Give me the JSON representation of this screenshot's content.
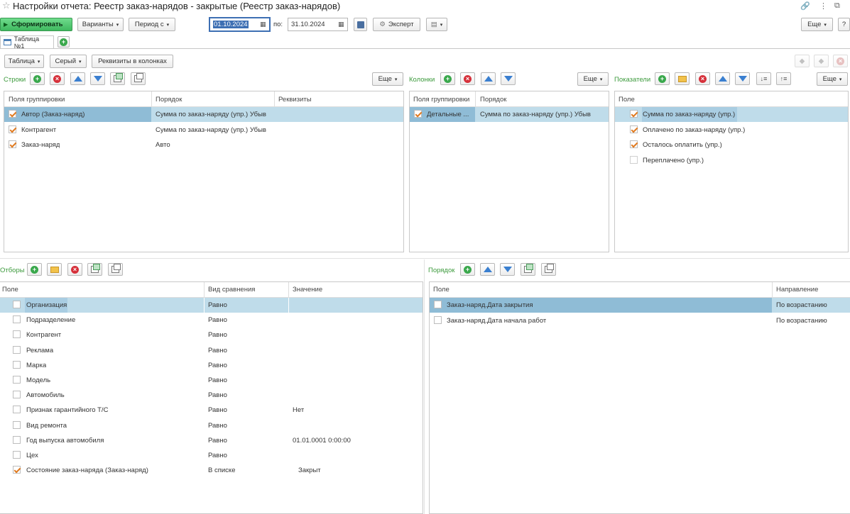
{
  "title": "Настройки отчета: Реестр заказ-нарядов - закрытые (Реестр заказ-нарядов)",
  "toolbar": {
    "generate": "Сформировать",
    "variants": "Варианты",
    "period_from": "Период с",
    "date_from": "01.10.2024",
    "to_label": "по:",
    "date_to": "31.10.2024",
    "expert": "Эксперт",
    "more": "Еще",
    "help": "?"
  },
  "tab": {
    "label": "Таблица №1"
  },
  "sub_toolbar": {
    "table": "Таблица",
    "style": "Серый",
    "attrs_in_columns": "Реквизиты в колонках"
  },
  "rows_panel": {
    "label": "Строки",
    "more": "Еще",
    "headers": [
      "Поля группировки",
      "Порядок",
      "Реквизиты"
    ],
    "rows": [
      {
        "field": "Автор (Заказ-наряд)",
        "order": "Сумма по заказ-наряду (упр.) Убыв",
        "checked": true
      },
      {
        "field": "Контрагент",
        "order": "Сумма по заказ-наряду (упр.) Убыв",
        "checked": true
      },
      {
        "field": "Заказ-наряд",
        "order": "Авто",
        "checked": true
      }
    ]
  },
  "columns_panel": {
    "label": "Колонки",
    "more": "Еще",
    "headers": [
      "Поля группировки",
      "Порядок"
    ],
    "rows": [
      {
        "field": "Детальные ...",
        "order": "Сумма по заказ-наряду (упр.) Убыв",
        "checked": true
      }
    ]
  },
  "indicators_panel": {
    "label": "Показатели",
    "more": "Еще",
    "headers": [
      "Поле"
    ],
    "rows": [
      {
        "field": "Сумма по заказ-наряду (упр.)",
        "checked": true
      },
      {
        "field": "Оплачено по заказ-наряду (упр.)",
        "checked": true
      },
      {
        "field": "Осталось оплатить (упр.)",
        "checked": true
      },
      {
        "field": "Переплачено (упр.)",
        "checked": false
      }
    ]
  },
  "filters_panel": {
    "label": "Отборы",
    "headers": [
      "Поле",
      "Вид сравнения",
      "Значение"
    ],
    "rows": [
      {
        "field": "Организация",
        "cmp": "Равно",
        "value": "",
        "checked": false
      },
      {
        "field": "Подразделение",
        "cmp": "Равно",
        "value": "",
        "checked": false
      },
      {
        "field": "Контрагент",
        "cmp": "Равно",
        "value": "",
        "checked": false
      },
      {
        "field": "Реклама",
        "cmp": "Равно",
        "value": "",
        "checked": false
      },
      {
        "field": "Марка",
        "cmp": "Равно",
        "value": "",
        "checked": false
      },
      {
        "field": "Модель",
        "cmp": "Равно",
        "value": "",
        "checked": false
      },
      {
        "field": "Автомобиль",
        "cmp": "Равно",
        "value": "",
        "checked": false
      },
      {
        "field": "Признак гарантийного Т/С",
        "cmp": "Равно",
        "value": "Нет",
        "checked": false
      },
      {
        "field": "Вид ремонта",
        "cmp": "Равно",
        "value": "",
        "checked": false
      },
      {
        "field": "Год выпуска автомобиля",
        "cmp": "Равно",
        "value": "01.01.0001 0:00:00",
        "checked": false
      },
      {
        "field": "Цех",
        "cmp": "Равно",
        "value": "",
        "checked": false
      },
      {
        "field": "Состояние заказ-наряда (Заказ-наряд)",
        "cmp": "В списке",
        "value": "Закрыт",
        "checked": true
      }
    ]
  },
  "order_panel": {
    "label": "Порядок",
    "headers": [
      "Поле",
      "Направление"
    ],
    "rows": [
      {
        "field": "Заказ-наряд.Дата закрытия",
        "dir": "По возрастанию",
        "checked": false
      },
      {
        "field": "Заказ-наряд.Дата начала работ",
        "dir": "По возрастанию",
        "checked": false
      }
    ]
  }
}
